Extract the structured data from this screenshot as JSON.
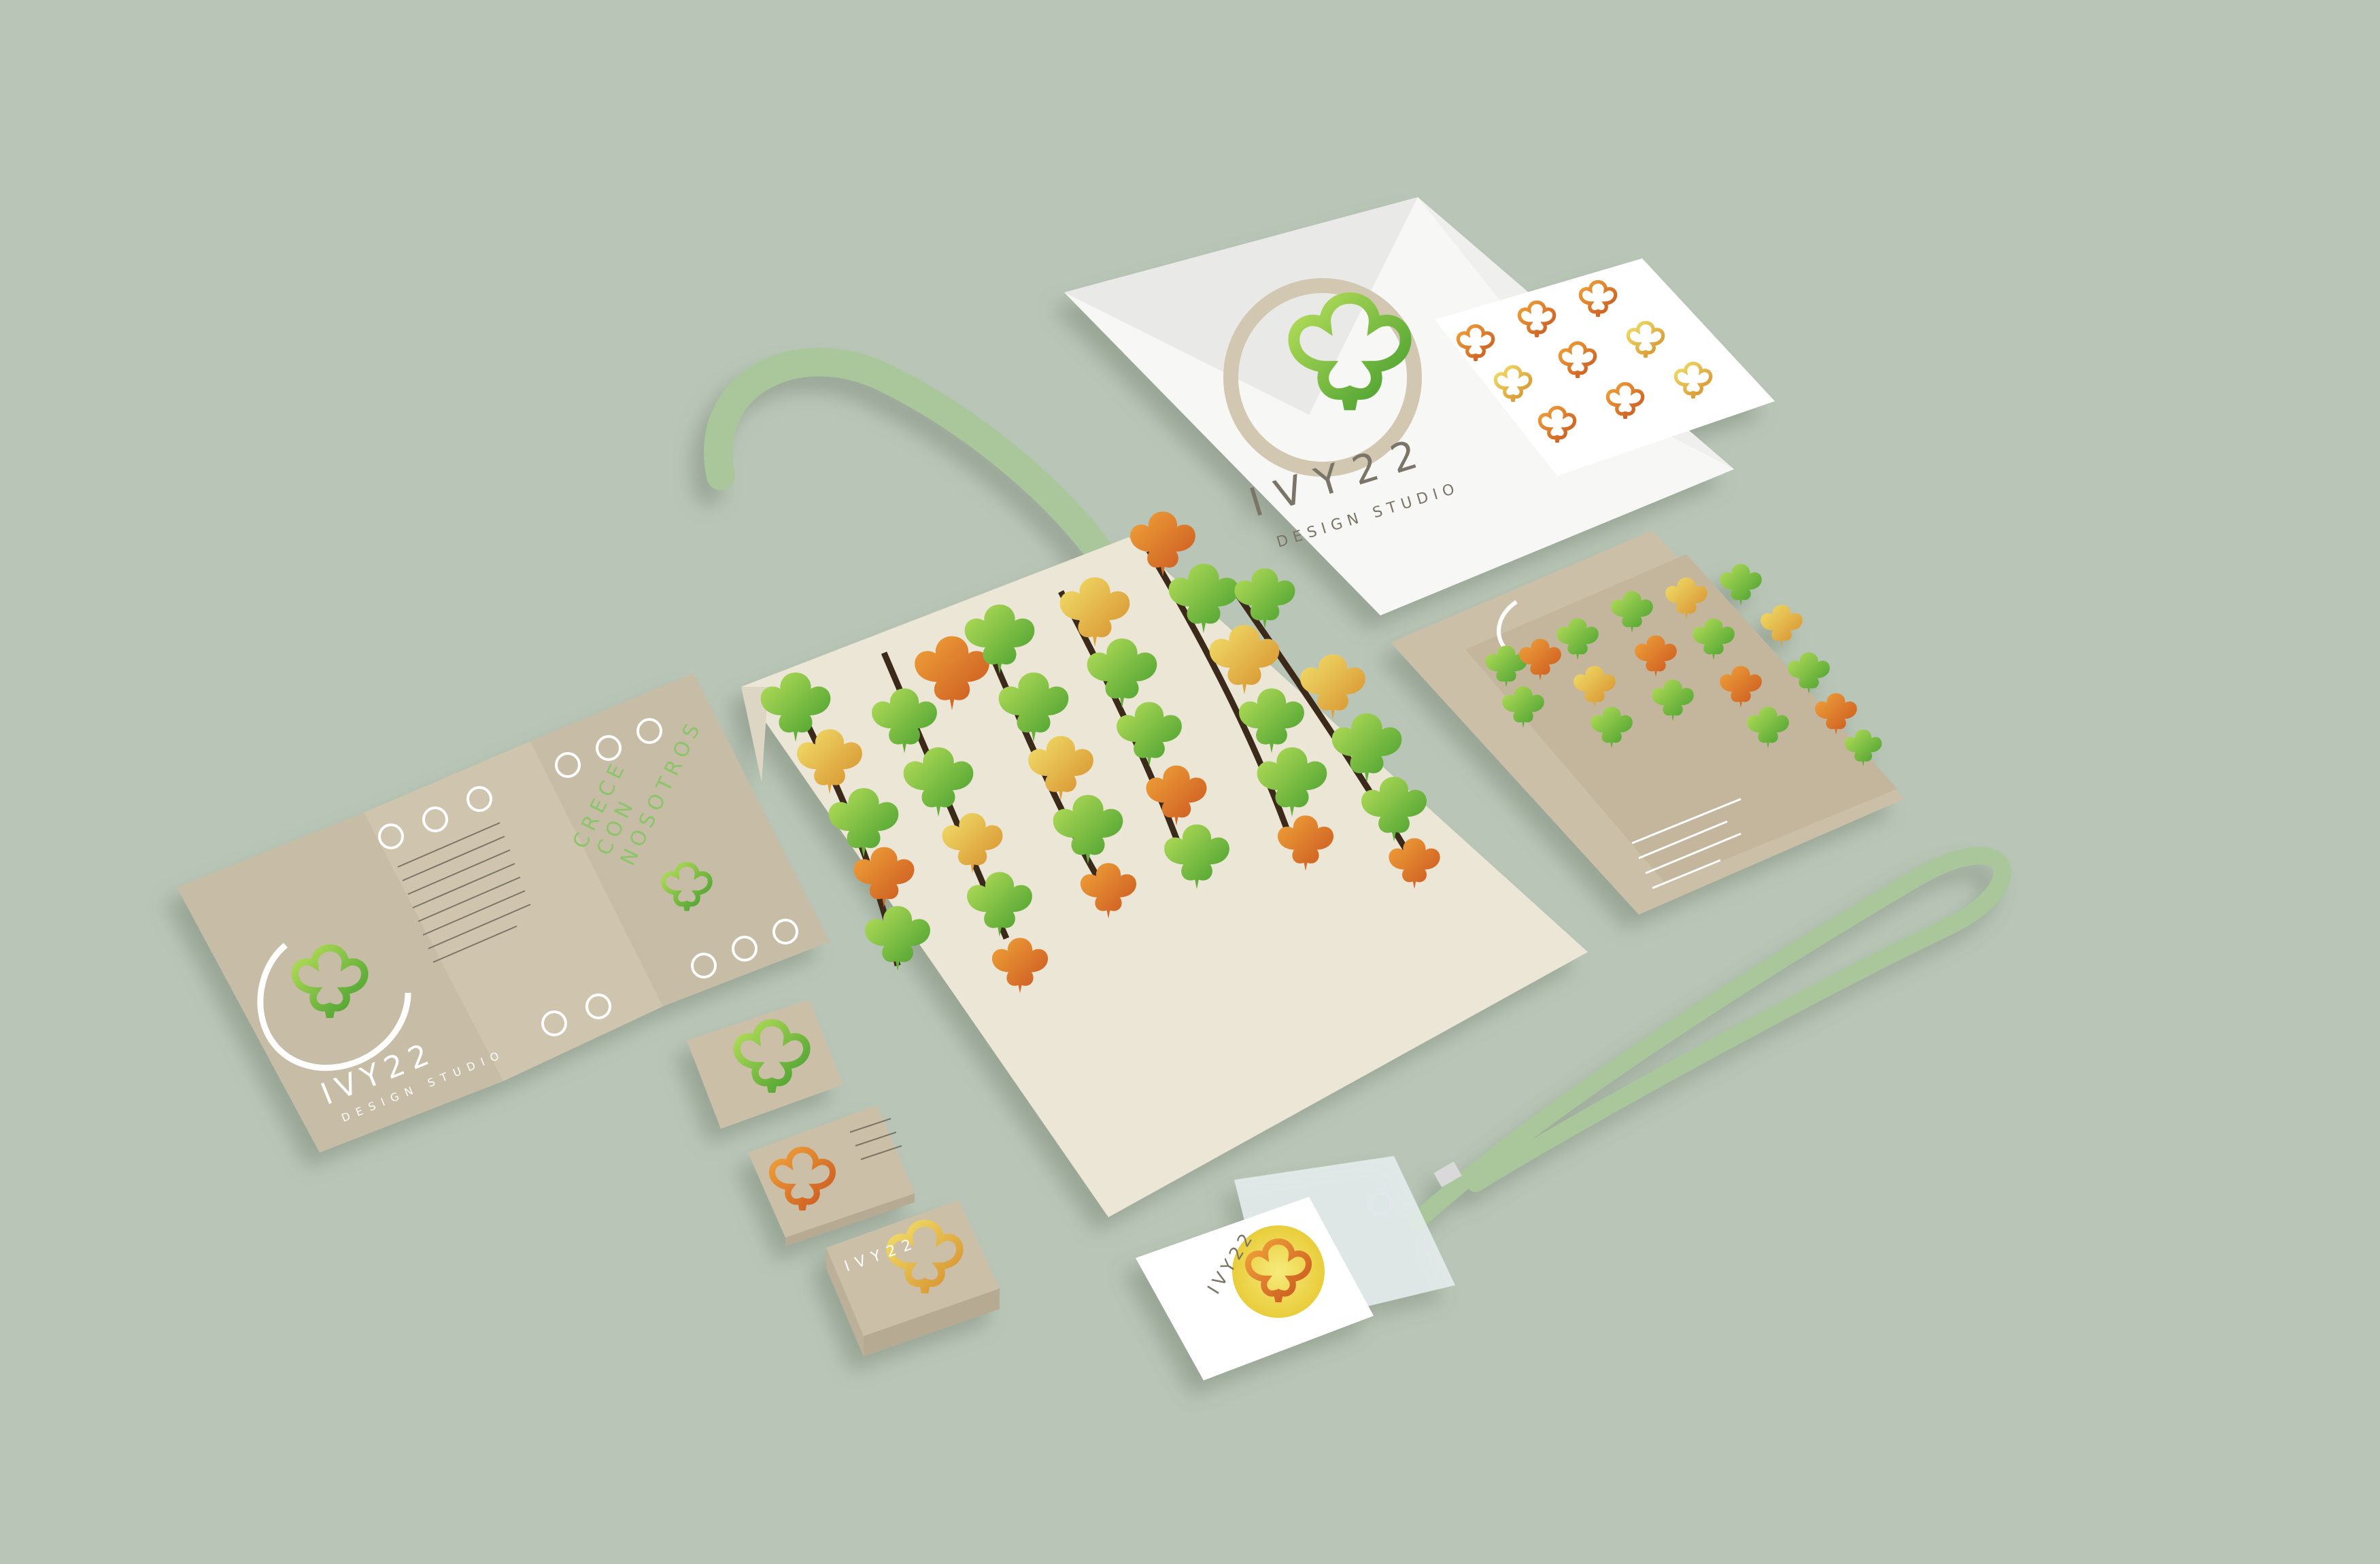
{
  "brand": {
    "name": "IVY22",
    "tagline": "DESIGN STUDIO"
  },
  "brochure": {
    "slogan_line1": "CRECE",
    "slogan_line2": "CON",
    "slogan_line3": "NOSOTROS"
  },
  "colors": {
    "background": "#b9c6b7",
    "kraft": "#cbbfa8",
    "canvas": "#ece6d7",
    "strap": "#a9c79a",
    "leaf_green": "#5aa532",
    "leaf_orange": "#e27a2a",
    "leaf_yellow": "#d9c43a"
  },
  "items": {
    "tote_bag": "tote-bag",
    "envelope": "envelope",
    "brochure": "trifold-brochure",
    "business_cards": "business-card-stack",
    "folder": "folder",
    "badge": "id-badge-lanyard"
  },
  "icons": {
    "logo": "ivy-leaf-icon"
  }
}
